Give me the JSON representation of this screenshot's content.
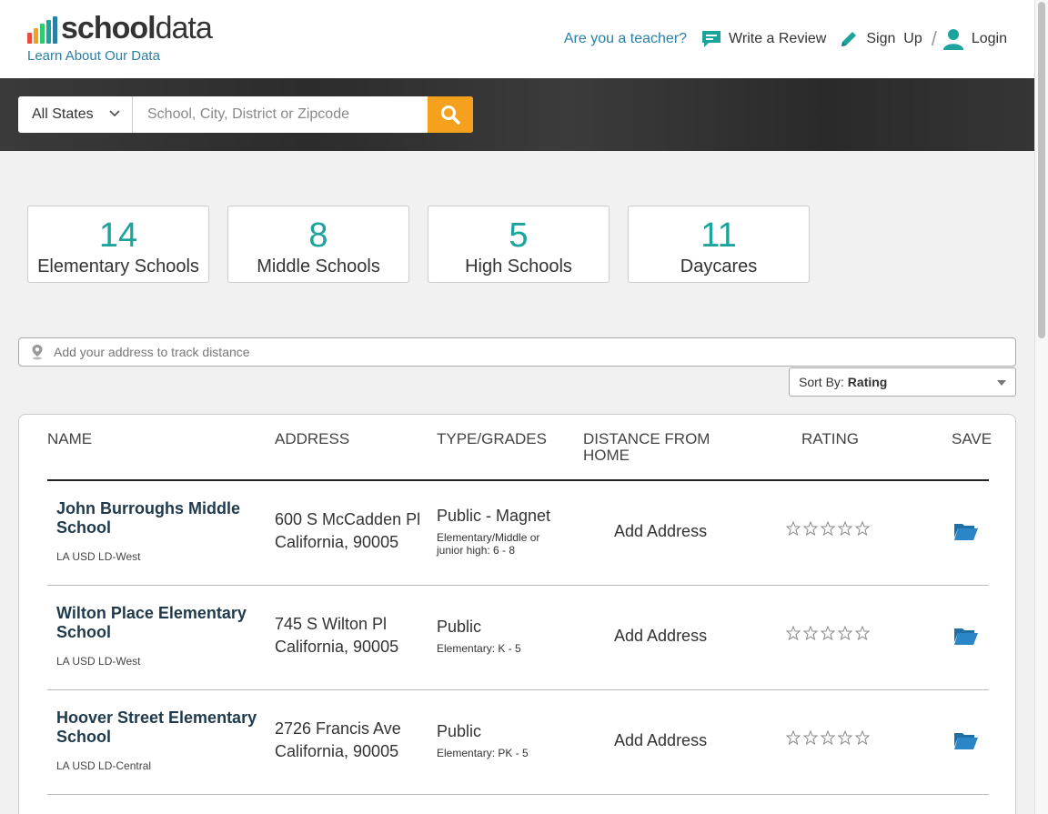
{
  "header": {
    "logo_part1": "school",
    "logo_part2": "data",
    "logo_bar_colors": [
      "#e84c3d",
      "#f5a11e",
      "#2ecc71",
      "#1ba39c",
      "#2a7fa8"
    ],
    "learn_link": "Learn About Our Data",
    "teacher_link": "Are you a teacher?",
    "write_review": "Write a Review",
    "sign_up": "Sign  Up",
    "slash": "/",
    "login": "Login"
  },
  "search": {
    "state_selected": "All States",
    "placeholder": "School, City, District or Zipcode",
    "button_color": "#f5a11e"
  },
  "stats": [
    {
      "count": "14",
      "label": "Elementary Schools"
    },
    {
      "count": "8",
      "label": "Middle Schools"
    },
    {
      "count": "5",
      "label": "High Schools"
    },
    {
      "count": "11",
      "label": "Daycares"
    }
  ],
  "address": {
    "placeholder": "Add your address to track distance"
  },
  "sort": {
    "label": "Sort By:",
    "value": "Rating"
  },
  "table": {
    "headers": {
      "name": "NAME",
      "address": "ADDRESS",
      "type": "TYPE/GRADES",
      "distance_1": "DISTANCE FROM",
      "distance_2": "HOME",
      "rating": "RATING",
      "save": "SAVE"
    },
    "rows": [
      {
        "name": "John Burroughs Middle School",
        "district": "LA USD LD-West",
        "street": "600 S McCadden Pl",
        "city": "California, 90005",
        "type": "Public - Magnet",
        "grades": "Elementary/Middle or junior high: 6 - 8",
        "distance": "Add Address"
      },
      {
        "name": "Wilton Place Elementary School",
        "district": "LA USD LD-West",
        "street": "745 S Wilton Pl",
        "city": "California, 90005",
        "type": "Public",
        "grades": "Elementary: K - 5",
        "distance": "Add Address"
      },
      {
        "name": "Hoover Street Elementary School",
        "district": "LA USD LD-Central",
        "street": "2726 Francis Ave",
        "city": "California, 90005",
        "type": "Public",
        "grades": "Elementary: PK - 5",
        "distance": "Add Address"
      }
    ]
  },
  "colors": {
    "accent_teal": "#1ba39c",
    "link_blue": "#2a7fa8",
    "folder_blue": "#2a7fa8"
  }
}
